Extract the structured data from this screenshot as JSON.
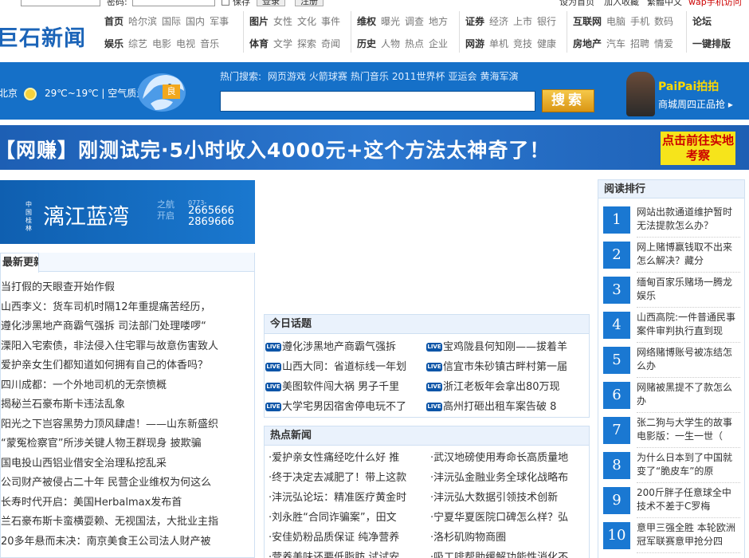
{
  "topbar": {
    "password_label": "密码:",
    "save_label": "保存",
    "login_label": "登录",
    "register_label": "注册",
    "set_home": "设为首页",
    "add_fav": "加入收藏",
    "other": "繁體中文",
    "wap": "wap手机访问"
  },
  "logo": "巨石新闻",
  "nav": [
    {
      "rows": [
        [
          "首页",
          "哈尔滨",
          "国际",
          "国内",
          "军事"
        ],
        [
          "娱乐",
          "综艺",
          "电影",
          "电视",
          "音乐"
        ]
      ]
    },
    {
      "rows": [
        [
          "图片",
          "女性",
          "文化",
          "事件"
        ],
        [
          "体育",
          "文学",
          "探索",
          "奇闻"
        ]
      ]
    },
    {
      "rows": [
        [
          "维权",
          "曝光",
          "调查",
          "地方"
        ],
        [
          "历史",
          "人物",
          "热点",
          "企业"
        ]
      ]
    },
    {
      "rows": [
        [
          "证券",
          "经济",
          "上市",
          "银行"
        ],
        [
          "网游",
          "单机",
          "竞技",
          "健康"
        ]
      ]
    },
    {
      "rows": [
        [
          "互联网",
          "电脑",
          "手机",
          "数码"
        ],
        [
          "房地产",
          "汽车",
          "招聘",
          "情爱"
        ]
      ]
    },
    {
      "rows": [
        [
          "论坛"
        ],
        [
          "一键排版"
        ]
      ]
    }
  ],
  "weather": {
    "city": "北京",
    "temp": "29℃~19℃",
    "air_label": "| 空气质量",
    "aqi": "良"
  },
  "search": {
    "hot_label": "热门搜索:",
    "hot_items": [
      "网页游戏",
      "火箭球赛",
      "热门音乐",
      "2011世界杯",
      "亚运会",
      "黄海军演"
    ],
    "button": "搜索",
    "placeholder": ""
  },
  "paipai": {
    "brand": "PaiPai拍拍",
    "text": "商城周四正品抢 ▸"
  },
  "ad": {
    "headline": "【网赚】刚测试完·5小时收入4000元+这个方法太神奇了！",
    "cta": "点击前往实地考察"
  },
  "left_promo": {
    "small": "中国桂林",
    "title": "漓江蓝湾",
    "sub": "之航开启",
    "area": "0773-",
    "tel1": "2665666",
    "tel2": "2869666"
  },
  "latest": {
    "tab": "最新更新",
    "items": [
      "当打假的天眼查开始作假",
      "山西李义：货车司机时隔12年重提痛苦经历，",
      "遵化涉黑地产商霸气强拆 司法部门处理喽啰“",
      "溧阳入宅索债，非法侵入住宅罪与故意伤害致人",
      "爱护亲女生们都知道如何拥有自己的体香吗？",
      "四川成都：一个外地司机的无奈愤概",
      "揭秘兰石豪布斯卡违法乱象",
      "阳光之下岂容黑势力顶风肆虐！——山东新盛织",
      "“蒙冤检察官”所涉关键人物王群现身 披欺骗",
      "国电投山西铝业借安全治理私挖乱采",
      "公司财产被侵占二十年 民营企业维权为何这么",
      "长寿时代开启：美国Herbalmax发布首",
      "兰石豪布斯卡蛮横耍赖、无视国法，大批业主指",
      "20多年悬而未决：南京美食王公司法人财产被"
    ]
  },
  "topics": {
    "title": "今日话题",
    "live_label": "LIVE",
    "items": [
      "遵化涉黑地产商霸气强拆",
      "宝鸡陇县何知刚——拔着羊",
      "山西大同：省道标线一年划",
      "信宜市朱砂镇古畔村第一届",
      "美图软件闯大祸 男子千里",
      "浙江老板年会拿出80万现",
      "大学宅男因宿舍停电玩不了",
      "高州打砸出租车案告破 8"
    ]
  },
  "hotnews": {
    "title": "热点新闻",
    "items": [
      "爱护亲女性痛经吃什么好 推",
      "武汉地磅使用寿命长高质量地",
      "终于决定去减肥了！带上这款",
      "沣沅弘金融业务全球化战略布",
      "沣沅弘论坛：精准医疗黄金时",
      "沣沅弘大数据引领技术创新",
      "刘永胜“合同诈骗案”，田文",
      "宁夏华夏医院口碑怎么样？弘",
      "安佳奶粉品质保证 纯净营养",
      "洛杉矶购物商圈",
      "营养美味还要低脂肪 试试安",
      "吸工啡帮助缓解功能性消化不"
    ]
  },
  "ranking": {
    "title": "阅读排行",
    "items": [
      {
        "n": "1",
        "t": "网站出款通道维护暂时无法提款怎么办？"
      },
      {
        "n": "2",
        "t": "网上赌博赢钱取不出来怎么解决？藏分"
      },
      {
        "n": "3",
        "t": "缅甸百家乐赌场一腾龙娱乐"
      },
      {
        "n": "4",
        "t": "山西高院:一件普通民事案件审判执行直到现"
      },
      {
        "n": "5",
        "t": "网络赌博账号被冻结怎么办"
      },
      {
        "n": "6",
        "t": "网赌被黑提不了款怎么办"
      },
      {
        "n": "7",
        "t": "张二狗与大学生的故事电影版：一生一世（"
      },
      {
        "n": "8",
        "t": "为什么日本到了中国就变了“脆皮车”的原"
      },
      {
        "n": "9",
        "t": "200斤胖子任意球全中技术不差于C罗梅"
      },
      {
        "n": "10",
        "t": "意甲三强全胜 本轮欧洲冠军联赛意甲抢分四"
      }
    ]
  },
  "colors": {
    "brand_blue": "#1570c8",
    "accent_yellow": "#f6e41b",
    "rank_blue": "#1a78d2"
  }
}
